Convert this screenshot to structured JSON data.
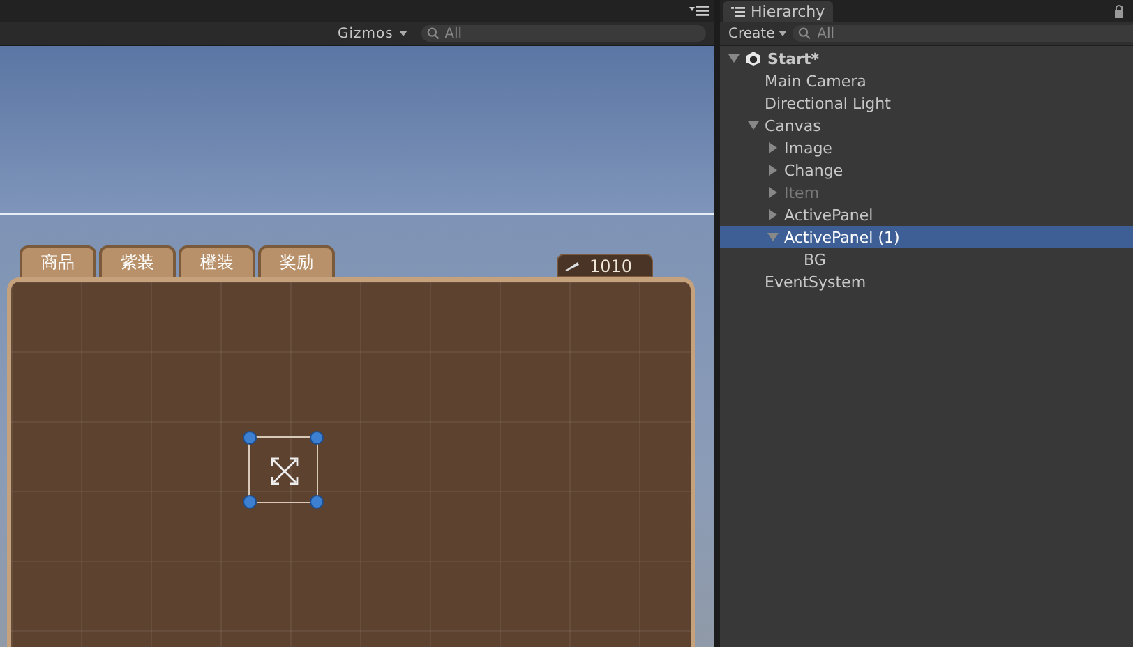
{
  "scene": {
    "toolbar": {
      "gizmos": "Gizmos",
      "search_placeholder": "All"
    },
    "tabs": [
      {
        "label": "商品",
        "selected": false
      },
      {
        "label": "紫装",
        "selected": false
      },
      {
        "label": "橙装",
        "selected": false
      },
      {
        "label": "奖励",
        "selected": false
      }
    ],
    "currency": "1010"
  },
  "hierarchy": {
    "title": "Hierarchy",
    "create": "Create",
    "search_placeholder": "All",
    "tree": [
      {
        "label": "Start*",
        "expanded": true,
        "selected": false,
        "disabled": false,
        "children": [
          {
            "label": "Main Camera",
            "selected": false,
            "disabled": false
          },
          {
            "label": "Directional Light",
            "selected": false,
            "disabled": false
          },
          {
            "label": "Canvas",
            "expanded": true,
            "selected": false,
            "disabled": false,
            "children": [
              {
                "label": "Image",
                "expanded": false,
                "selected": false,
                "disabled": false
              },
              {
                "label": "Change",
                "expanded": false,
                "selected": false,
                "disabled": false
              },
              {
                "label": "Item",
                "expanded": false,
                "selected": false,
                "disabled": true
              },
              {
                "label": "ActivePanel",
                "expanded": false,
                "selected": false,
                "disabled": false
              },
              {
                "label": "ActivePanel (1)",
                "expanded": true,
                "selected": true,
                "disabled": false,
                "children": [
                  {
                    "label": "BG",
                    "selected": false,
                    "disabled": false
                  }
                ]
              }
            ]
          },
          {
            "label": "EventSystem",
            "selected": false,
            "disabled": false
          }
        ]
      }
    ]
  }
}
